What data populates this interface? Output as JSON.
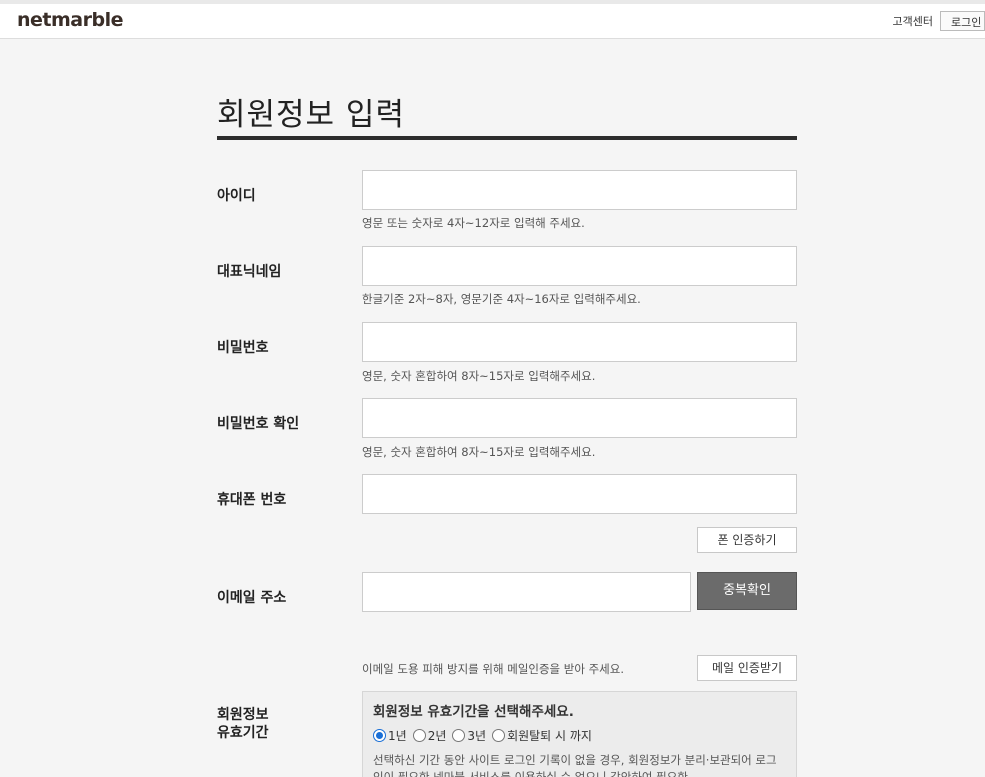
{
  "header": {
    "logo": "netmarble",
    "help_link": "고객센터",
    "login_label": "로그인"
  },
  "page": {
    "title": "회원정보 입력"
  },
  "form": {
    "id": {
      "label": "아이디",
      "value": "",
      "hint": "영문 또는 숫자로 4자~12자로 입력해 주세요."
    },
    "nickname": {
      "label": "대표닉네임",
      "value": "",
      "hint": "한글기준 2자~8자, 영문기준 4자~16자로 입력해주세요."
    },
    "password": {
      "label": "비밀번호",
      "value": "",
      "hint": "영문, 숫자 혼합하여 8자~15자로 입력해주세요."
    },
    "password_confirm": {
      "label": "비밀번호 확인",
      "value": "",
      "hint": "영문, 숫자 혼합하여 8자~15자로 입력해주세요."
    },
    "phone": {
      "label": "휴대폰 번호",
      "value": "",
      "verify_button": "폰 인증하기"
    },
    "email": {
      "label": "이메일 주소",
      "value": "",
      "dup_check_button": "중복확인",
      "hint": "이메일 도용 피해 방지를 위해 메일인증을 받아 주세요.",
      "verify_button": "메일 인증받기"
    },
    "validity": {
      "label_line1": "회원정보",
      "label_line2": "유효기간",
      "title": "회원정보 유효기간을 선택해주세요.",
      "options": [
        "1년",
        "2년",
        "3년",
        "회원탈퇴 시 까지"
      ],
      "selected": "1년",
      "description": "선택하신 기간 동안 사이트 로그인 기록이 없을 경우, 회원정보가 분리·보관되어 로그인이 필요한 넷마블 서비스를 이용하실 수 없으니 감안하여 필요한"
    }
  }
}
